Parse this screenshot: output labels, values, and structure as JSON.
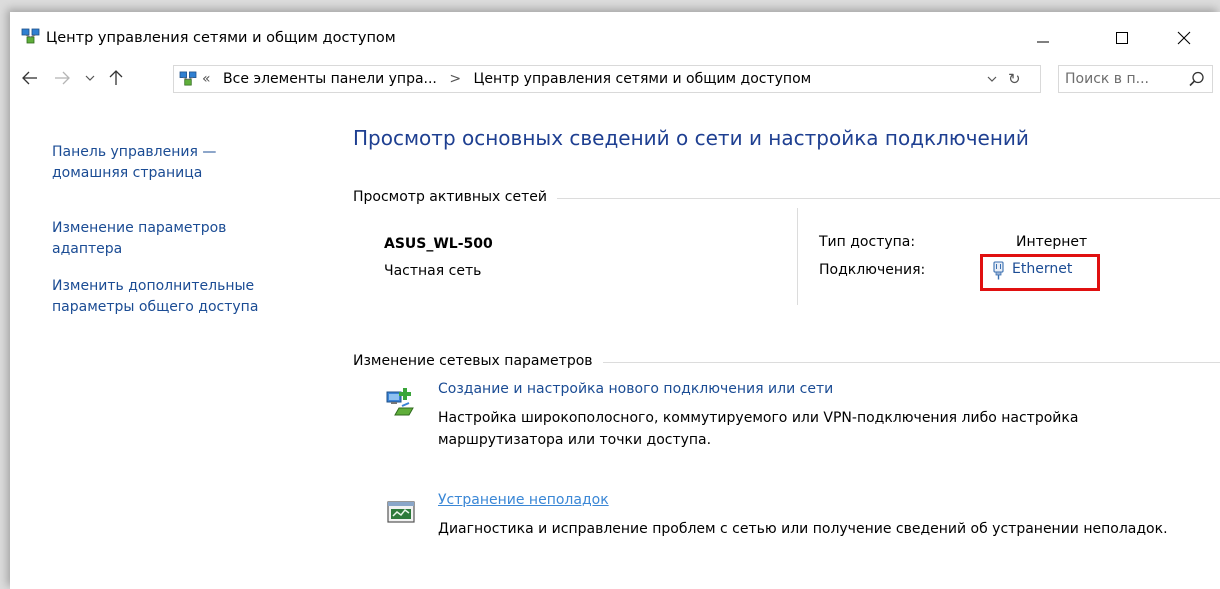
{
  "window": {
    "title": "Центр управления сетями и общим доступом",
    "controls": {
      "minimize_icon": "minimize-icon",
      "maximize_icon": "maximize-icon",
      "close_icon": "close-icon"
    }
  },
  "address_bar": {
    "overflow": "«",
    "breadcrumbs": [
      "Все элементы панели упра...",
      "Центр управления сетями и общим доступом"
    ],
    "separator": ">",
    "search_placeholder": "Поиск в п..."
  },
  "sidebar": {
    "items": [
      {
        "label": "Панель управления — домашняя страница"
      },
      {
        "label": "Изменение параметров адаптера"
      },
      {
        "label": "Изменить дополнительные параметры общего доступа"
      }
    ]
  },
  "main": {
    "title": "Просмотр основных сведений о сети и настройка подключений",
    "active_networks_header": "Просмотр активных сетей",
    "network": {
      "name": "ASUS_WL-500",
      "type": "Частная сеть",
      "access_type_label": "Тип доступа:",
      "access_type_value": "Интернет",
      "connections_label": "Подключения:",
      "connection_name": "Ethernet"
    },
    "change_settings_header": "Изменение сетевых параметров",
    "tasks": [
      {
        "title": "Создание и настройка нового подключения или сети",
        "description": "Настройка широкополосного, коммутируемого или VPN-подключения либо настройка маршрутизатора или точки доступа."
      },
      {
        "title": "Устранение неполадок",
        "description": "Диагностика и исправление проблем с сетью или получение сведений об устранении неполадок."
      }
    ]
  },
  "colors": {
    "link": "#1b4c94",
    "title": "#1e3f91",
    "highlight_border": "#e01010"
  }
}
